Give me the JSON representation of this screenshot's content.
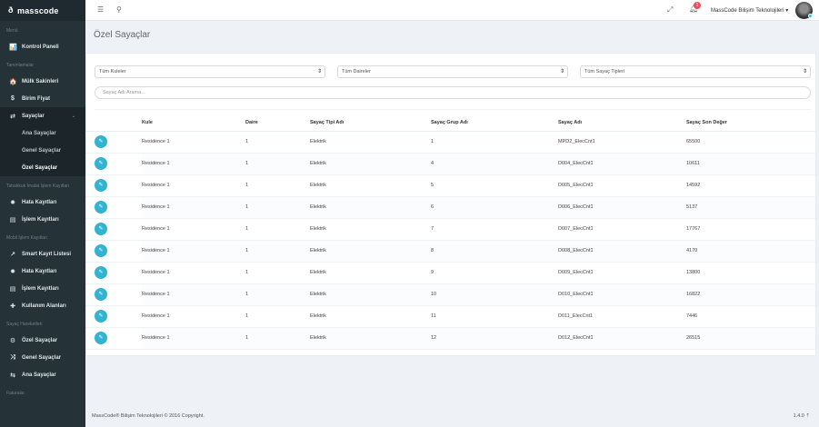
{
  "brand": {
    "name": "masscode"
  },
  "sidebar": {
    "sections": [
      {
        "title": "Menü",
        "items": [
          {
            "label": "Kontrol Paneli",
            "icon": "bar-chart-icon",
            "glyph": "📊"
          }
        ]
      },
      {
        "title": "Tanımlamalar",
        "items": [
          {
            "label": "Mülk Sakinleri",
            "icon": "home-icon",
            "glyph": "🏠"
          },
          {
            "label": "Birim Fiyat",
            "icon": "dollar-icon",
            "glyph": "$"
          },
          {
            "label": "Sayaçlar",
            "icon": "swap-icon",
            "glyph": "⇄",
            "open": true,
            "children": [
              {
                "label": "Ana Sayaçlar"
              },
              {
                "label": "Genel Sayaçlar"
              },
              {
                "label": "Özel Sayaçlar",
                "active": true
              }
            ]
          }
        ]
      },
      {
        "title": "Tahakkuk İmalat İşlem Kayıtları",
        "items": [
          {
            "label": "Hata Kayıtları",
            "icon": "bug-icon",
            "glyph": "✹"
          },
          {
            "label": "İşlem Kayıtları",
            "icon": "list-icon",
            "glyph": "▤"
          }
        ]
      },
      {
        "title": "Mobil İşlem Kayıtları",
        "items": [
          {
            "label": "Smart Kayıt Listesi",
            "icon": "chart-line-icon",
            "glyph": "↗"
          },
          {
            "label": "Hata Kayıtları",
            "icon": "bug-icon",
            "glyph": "✹"
          },
          {
            "label": "İşlem Kayıtları",
            "icon": "list-icon",
            "glyph": "▤"
          },
          {
            "label": "Kullanım Alanları",
            "icon": "plus-icon",
            "glyph": "✚"
          }
        ]
      },
      {
        "title": "Sayaç Hareketleri",
        "items": [
          {
            "label": "Özel Sayaçlar",
            "icon": "cog-icon",
            "glyph": "⚙"
          },
          {
            "label": "Genel Sayaçlar",
            "icon": "shuffle-icon",
            "glyph": "⤨"
          },
          {
            "label": "Ana Sayaçlar",
            "icon": "loop-icon",
            "glyph": "⇆"
          }
        ]
      },
      {
        "title": "Faturalar",
        "items": []
      }
    ]
  },
  "topbar": {
    "notifications_count": "1",
    "user_name": "MassCode Bilişim Teknolojileri"
  },
  "page": {
    "title": "Özel Sayaçlar"
  },
  "filters": {
    "kule": "Tüm Kuleler",
    "daire": "Tüm Daireler",
    "tip": "Tüm Sayaç Tipleri",
    "search_placeholder": "Sayaç Adı Arama..."
  },
  "table": {
    "columns": [
      "",
      "Kule",
      "Daire",
      "Sayaç Tipi Adı",
      "Sayaç Grup Adı",
      "Sayaç Adı",
      "Sayaç Son Değer"
    ],
    "rows": [
      [
        "Residence 1",
        "1",
        "Elektrik",
        "1",
        "MPD2_ElecCnt1",
        "65500"
      ],
      [
        "Residence 1",
        "1",
        "Elektrik",
        "4",
        "D004_ElecCnt1",
        "10611"
      ],
      [
        "Residence 1",
        "1",
        "Elektrik",
        "5",
        "D005_ElecCnt1",
        "14592"
      ],
      [
        "Residence 1",
        "1",
        "Elektrik",
        "6",
        "D006_ElecCnt1",
        "5137"
      ],
      [
        "Residence 1",
        "1",
        "Elektrik",
        "7",
        "D007_ElecCnt1",
        "17767"
      ],
      [
        "Residence 1",
        "1",
        "Elektrik",
        "8",
        "D008_ElecCnt1",
        "4170"
      ],
      [
        "Residence 1",
        "1",
        "Elektrik",
        "9",
        "D009_ElecCnt1",
        "13800"
      ],
      [
        "Residence 1",
        "1",
        "Elektrik",
        "10",
        "D010_ElecCnt1",
        "16822"
      ],
      [
        "Residence 1",
        "1",
        "Elektrik",
        "11",
        "D011_ElecCnt1",
        "7446"
      ],
      [
        "Residence 1",
        "1",
        "Elektrik",
        "12",
        "D012_ElecCnt1",
        "26515"
      ]
    ]
  },
  "footer": {
    "copyright": "MassCode® Bilişim Teknolojileri © 2016 Copyright.",
    "version": "1.4.0"
  },
  "colors": {
    "sidebar": "#253238",
    "accent": "#32b3cf",
    "badge": "#e7505a"
  }
}
